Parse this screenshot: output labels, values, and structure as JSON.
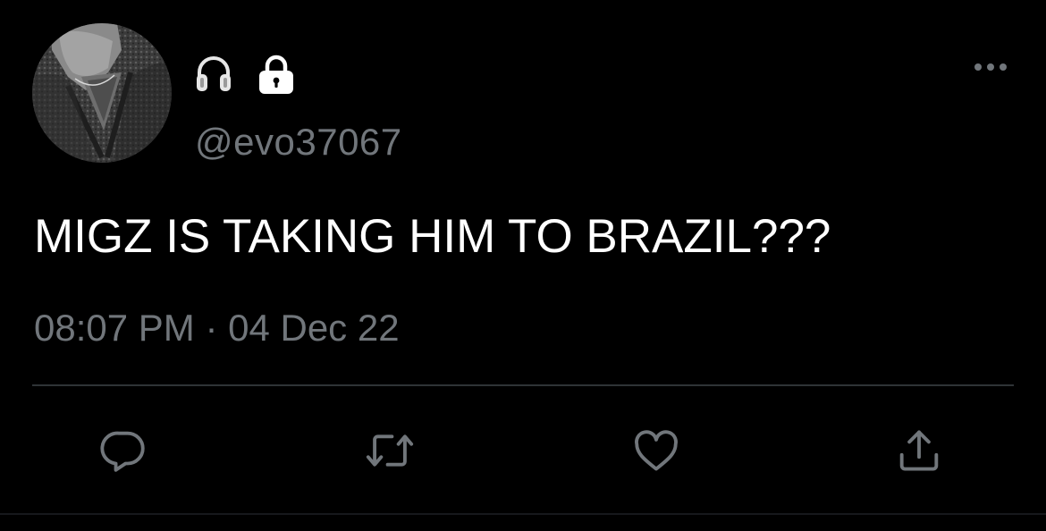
{
  "tweet": {
    "handle": "@evo37067",
    "text": "MIGZ IS TAKING HIM TO BRAZIL???",
    "timestamp": "08:07 PM · 04 Dec 22",
    "name_icons": [
      "headphones-icon",
      "lock-icon"
    ]
  },
  "actions": [
    "reply-icon",
    "retweet-icon",
    "like-icon",
    "share-icon"
  ],
  "colors": {
    "background": "#000000",
    "text_primary": "#ffffff",
    "text_secondary": "#71767b",
    "divider": "#2f3336"
  }
}
